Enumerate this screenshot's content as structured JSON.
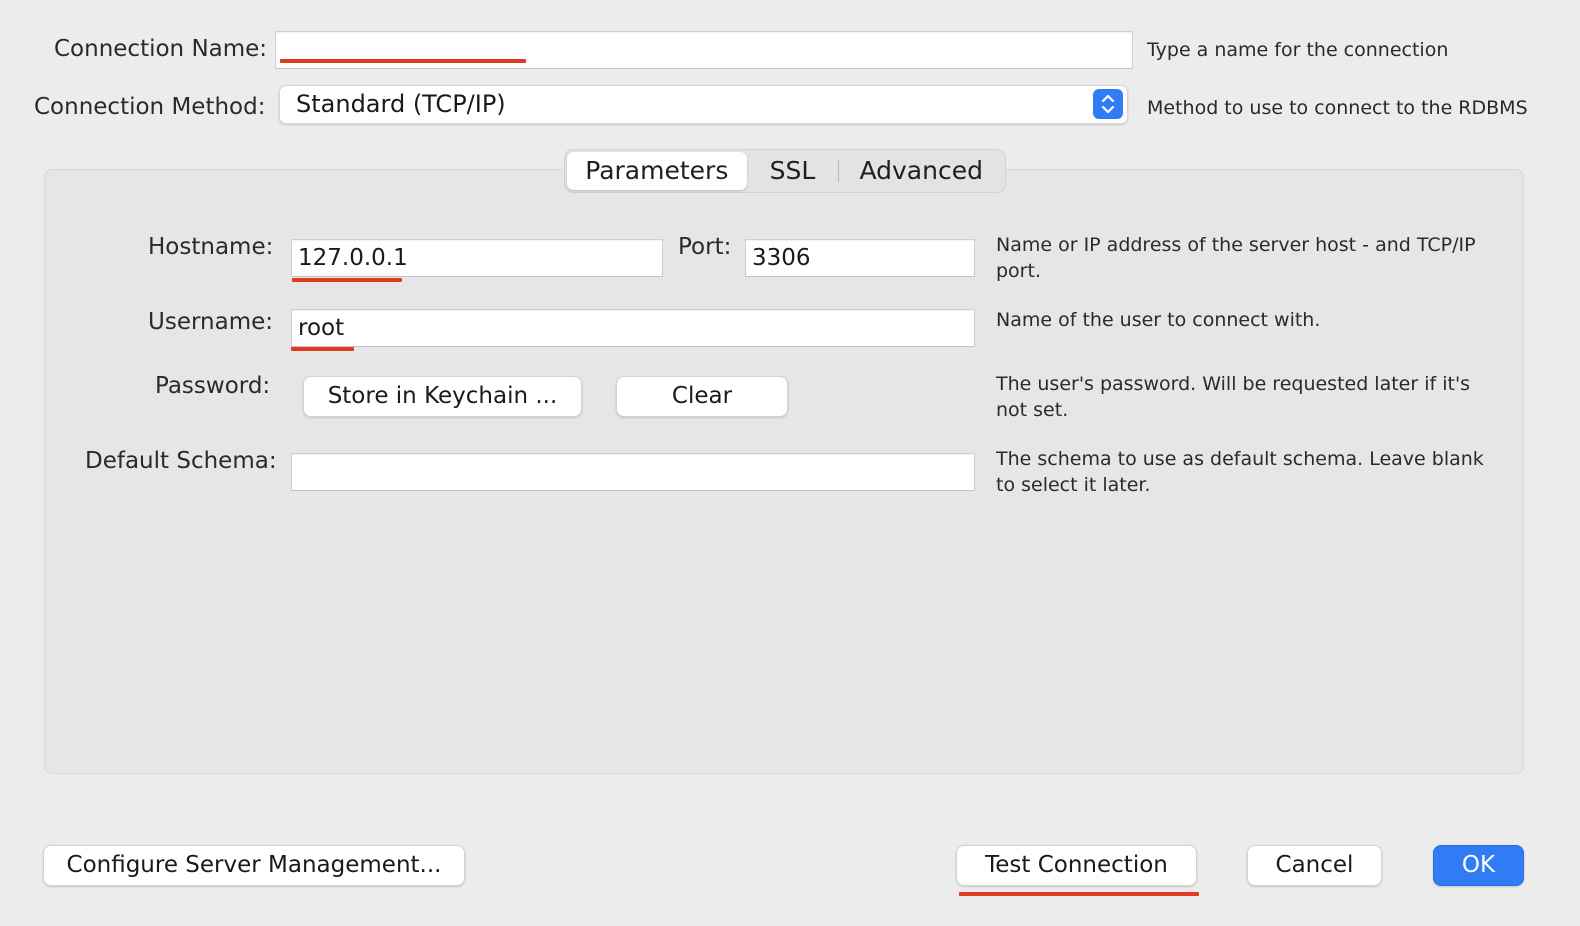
{
  "connection": {
    "name_label": "Connection Name:",
    "name_value": "",
    "name_hint": "Type a name for the connection",
    "method_label": "Connection Method:",
    "method_value": "Standard (TCP/IP)",
    "method_hint": "Method to use to connect to the RDBMS"
  },
  "tabs": [
    {
      "label": "Parameters",
      "active": true
    },
    {
      "label": "SSL",
      "active": false
    },
    {
      "label": "Advanced",
      "active": false
    }
  ],
  "parameters": {
    "hostname_label": "Hostname:",
    "hostname_value": "127.0.0.1",
    "port_label": "Port:",
    "port_value": "3306",
    "host_hint": "Name or IP address of the server host - and TCP/IP port.",
    "username_label": "Username:",
    "username_value": "root",
    "username_hint": "Name of the user to connect with.",
    "password_label": "Password:",
    "store_keychain_label": "Store in Keychain ...",
    "clear_label": "Clear",
    "password_hint": "The user's password. Will be requested later if it's not set.",
    "schema_label": "Default Schema:",
    "schema_value": "",
    "schema_hint": "The schema to use as default schema. Leave blank to select it later."
  },
  "footer": {
    "configure_label": "Configure Server Management...",
    "test_label": "Test Connection",
    "cancel_label": "Cancel",
    "ok_label": "OK"
  },
  "colors": {
    "accent": "#2f7cf6",
    "highlight_underline": "#e03a22",
    "background": "#ececec"
  }
}
